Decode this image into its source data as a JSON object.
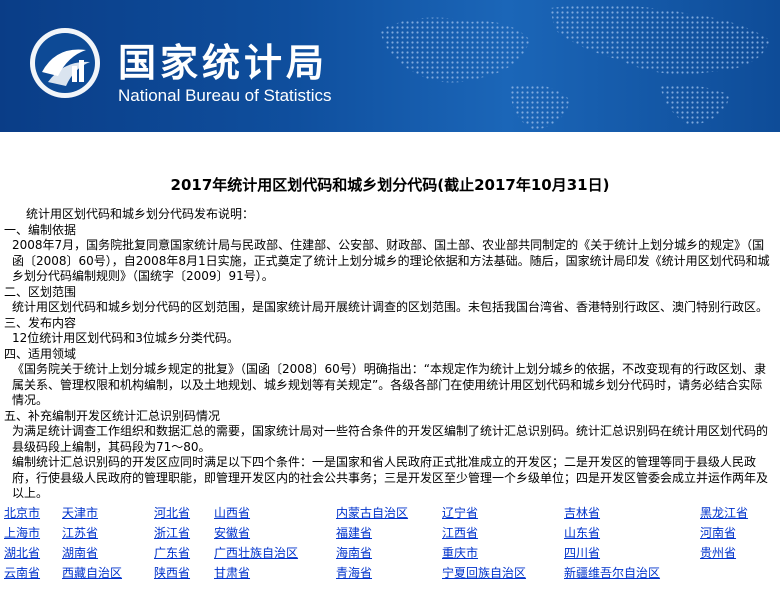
{
  "header": {
    "name_cn": "国家统计局",
    "name_en": "National Bureau of Statistics"
  },
  "page_title": "2017年统计用区划代码和城乡划分代码(截止2017年10月31日)",
  "intro": "统计用区划代码和城乡划分代码发布说明：",
  "sections": [
    {
      "heading": "一、编制依据",
      "paragraphs": [
        "2008年7月，国务院批复同意国家统计局与民政部、住建部、公安部、财政部、国土部、农业部共同制定的《关于统计上划分城乡的规定》（国函〔2008〕60号），自2008年8月1日实施，正式奠定了统计上划分城乡的理论依据和方法基础。随后，国家统计局印发《统计用区划代码和城乡划分代码编制规则》（国统字〔2009〕91号）。"
      ]
    },
    {
      "heading": "二、区划范围",
      "paragraphs": [
        "统计用区划代码和城乡划分代码的区划范围，是国家统计局开展统计调查的区划范围。未包括我国台湾省、香港特别行政区、澳门特别行政区。"
      ]
    },
    {
      "heading": "三、发布内容",
      "paragraphs": [
        "12位统计用区划代码和3位城乡分类代码。"
      ]
    },
    {
      "heading": "四、适用领域",
      "paragraphs": [
        "《国务院关于统计上划分城乡规定的批复》（国函〔2008〕60号）明确指出：“本规定作为统计上划分城乡的依据，不改变现有的行政区划、隶属关系、管理权限和机构编制，以及土地规划、城乡规划等有关规定”。各级各部门在使用统计用区划代码和城乡划分代码时，请务必结合实际情况。"
      ]
    },
    {
      "heading": "五、补充编制开发区统计汇总识别码情况",
      "paragraphs": [
        "为满足统计调查工作组织和数据汇总的需要，国家统计局对一些符合条件的开发区编制了统计汇总识别码。统计汇总识别码在统计用区划代码的县级码段上编制，其码段为71～80。",
        "编制统计汇总识别码的开发区应同时满足以下四个条件：一是国家和省人民政府正式批准成立的开发区；二是开发区的管理等同于县级人民政府，行使县级人民政府的管理职能，即管理开发区内的社会公共事务；三是开发区至少管理一个乡级单位；四是开发区管委会成立并运作两年及以上。"
      ]
    }
  ],
  "regions": [
    [
      "北京市",
      "天津市",
      "河北省",
      "山西省",
      "内蒙古自治区",
      "辽宁省",
      "吉林省",
      "黑龙江省"
    ],
    [
      "上海市",
      "江苏省",
      "浙江省",
      "安徽省",
      "福建省",
      "江西省",
      "山东省",
      "河南省"
    ],
    [
      "湖北省",
      "湖南省",
      "广东省",
      "广西壮族自治区",
      "海南省",
      "重庆市",
      "四川省",
      "贵州省"
    ],
    [
      "云南省",
      "西藏自治区",
      "陕西省",
      "甘肃省",
      "青海省",
      "宁夏回族自治区",
      "新疆维吾尔自治区",
      ""
    ]
  ]
}
